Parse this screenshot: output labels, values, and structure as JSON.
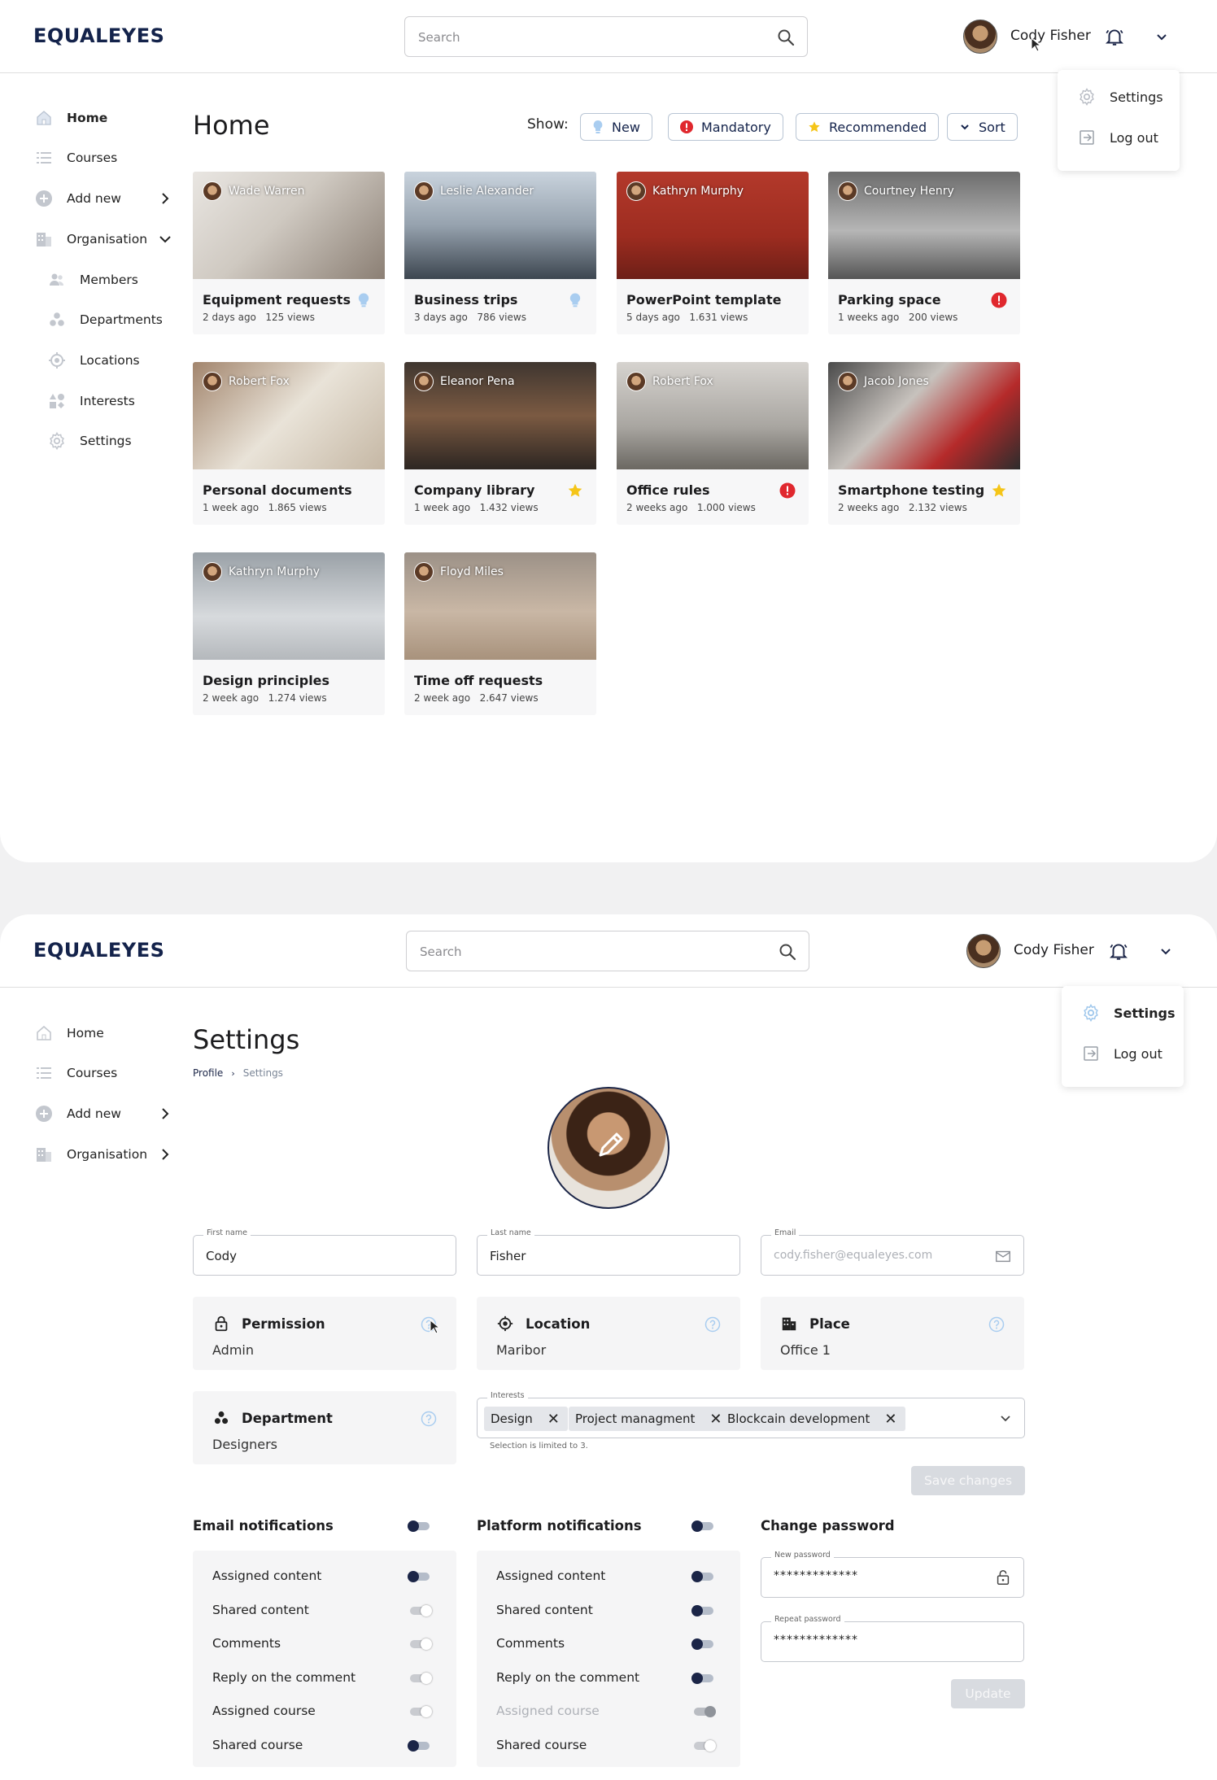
{
  "app": {
    "logo": "EQUALEYES"
  },
  "header": {
    "search_placeholder": "Search",
    "user_name": "Cody Fisher"
  },
  "user_menu": {
    "settings": "Settings",
    "logout": "Log out"
  },
  "home": {
    "title": "Home",
    "sidebar": {
      "home": "Home",
      "courses": "Courses",
      "add_new": "Add new",
      "organisation": "Organisation",
      "members": "Members",
      "departments": "Departments",
      "locations": "Locations",
      "interests": "Interests",
      "settings": "Settings"
    },
    "filters": {
      "show_label": "Show:",
      "new": "New",
      "mandatory": "Mandatory",
      "recommended": "Recommended",
      "sort": "Sort"
    },
    "cards": [
      {
        "author": "Wade Warren",
        "title": "Equipment requests",
        "age": "2 days ago",
        "views": "125 views",
        "badge": "new"
      },
      {
        "author": "Leslie Alexander",
        "title": "Business trips",
        "age": "3 days ago",
        "views": "786 views",
        "badge": "new"
      },
      {
        "author": "Kathryn Murphy",
        "title": "PowerPoint template",
        "age": "5 days ago",
        "views": "1.631 views",
        "badge": ""
      },
      {
        "author": "Courtney Henry",
        "title": "Parking space",
        "age": "1 weeks ago",
        "views": "200 views",
        "badge": "mandatory"
      },
      {
        "author": "Robert Fox",
        "title": "Personal documents",
        "age": "1 week ago",
        "views": "1.865 views",
        "badge": ""
      },
      {
        "author": "Eleanor Pena",
        "title": "Company library",
        "age": "1 week ago",
        "views": "1.432 views",
        "badge": "recommended"
      },
      {
        "author": "Robert Fox",
        "title": "Office rules",
        "age": "2 weeks ago",
        "views": "1.000 views",
        "badge": "mandatory"
      },
      {
        "author": "Jacob Jones",
        "title": "Smartphone testing",
        "age": "2 weeks ago",
        "views": "2.132 views",
        "badge": "recommended"
      },
      {
        "author": "Kathryn Murphy",
        "title": "Design principles",
        "age": "2 week ago",
        "views": "1.274 views",
        "badge": ""
      },
      {
        "author": "Floyd Miles",
        "title": "Time off requests",
        "age": "2 week ago",
        "views": "2.647 views",
        "badge": ""
      }
    ]
  },
  "settings": {
    "title": "Settings",
    "breadcrumb": {
      "profile": "Profile",
      "current": "Settings"
    },
    "sidebar": {
      "home": "Home",
      "courses": "Courses",
      "add_new": "Add new",
      "organisation": "Organisation"
    },
    "first_name": {
      "label": "First name",
      "value": "Cody"
    },
    "last_name": {
      "label": "Last name",
      "value": "Fisher"
    },
    "email": {
      "label": "Email",
      "placeholder": "cody.fisher@equaleyes.com"
    },
    "permission": {
      "title": "Permission",
      "value": "Admin"
    },
    "location": {
      "title": "Location",
      "value": "Maribor"
    },
    "place": {
      "title": "Place",
      "value": "Office 1"
    },
    "department": {
      "title": "Department",
      "value": "Designers"
    },
    "interests": {
      "label": "Interests",
      "tags": [
        "Design",
        "Project managment",
        "Blockcain development"
      ],
      "hint": "Selection is limited to 3."
    },
    "save_changes": "Save changes",
    "email_notifications": {
      "title": "Email notifications",
      "master": "on",
      "items": [
        {
          "label": "Assigned content",
          "state": "on"
        },
        {
          "label": "Shared content",
          "state": "off"
        },
        {
          "label": "Comments",
          "state": "off"
        },
        {
          "label": "Reply on the comment",
          "state": "off"
        },
        {
          "label": "Assigned course",
          "state": "off"
        },
        {
          "label": "Shared course",
          "state": "on"
        }
      ]
    },
    "platform_notifications": {
      "title": "Platform notifications",
      "master": "on",
      "items": [
        {
          "label": "Assigned content",
          "state": "on"
        },
        {
          "label": "Shared content",
          "state": "on"
        },
        {
          "label": "Comments",
          "state": "on"
        },
        {
          "label": "Reply on the comment",
          "state": "on"
        },
        {
          "label": "Assigned course",
          "state": "disabled"
        },
        {
          "label": "Shared course",
          "state": "off"
        }
      ]
    },
    "change_password": {
      "title": "Change password",
      "new_label": "New password",
      "new_value": "*************",
      "repeat_label": "Repeat password",
      "repeat_value": "*************",
      "update": "Update"
    }
  },
  "colors": {
    "brand": "#14234b",
    "toggle_on": "#1b2547",
    "mandatory": "#e0282e",
    "recommended": "#f5c518",
    "new": "#a9cdf0"
  }
}
